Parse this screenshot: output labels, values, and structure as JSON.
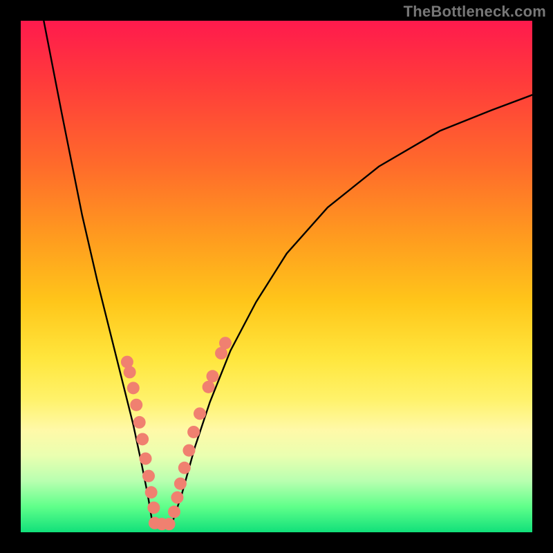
{
  "watermark": "TheBottleneck.com",
  "colors": {
    "curve": "#000000",
    "dot_fill": "#f08070",
    "dot_stroke": "#b0554a",
    "background_black": "#000000"
  },
  "chart_data": {
    "type": "line",
    "title": "",
    "xlabel": "",
    "ylabel": "",
    "xlim": [
      0,
      1
    ],
    "ylim": [
      0,
      1
    ],
    "series": [
      {
        "name": "left-branch",
        "x": [
          0.045,
          0.08,
          0.12,
          0.15,
          0.18,
          0.2,
          0.22,
          0.235,
          0.248,
          0.258
        ],
        "y": [
          1.0,
          0.82,
          0.62,
          0.49,
          0.37,
          0.29,
          0.21,
          0.14,
          0.075,
          0.015
        ]
      },
      {
        "name": "floor",
        "x": [
          0.258,
          0.295
        ],
        "y": [
          0.015,
          0.015
        ]
      },
      {
        "name": "right-branch",
        "x": [
          0.295,
          0.315,
          0.34,
          0.37,
          0.41,
          0.46,
          0.52,
          0.6,
          0.7,
          0.82,
          0.92,
          1.0
        ],
        "y": [
          0.015,
          0.075,
          0.165,
          0.255,
          0.355,
          0.45,
          0.545,
          0.635,
          0.715,
          0.785,
          0.825,
          0.855
        ]
      }
    ],
    "dot_groups": [
      {
        "name": "left-cluster",
        "points": [
          {
            "x": 0.208,
            "y": 0.333
          },
          {
            "x": 0.213,
            "y": 0.313
          },
          {
            "x": 0.22,
            "y": 0.282
          },
          {
            "x": 0.226,
            "y": 0.249
          },
          {
            "x": 0.232,
            "y": 0.215
          },
          {
            "x": 0.238,
            "y": 0.182
          },
          {
            "x": 0.244,
            "y": 0.144
          },
          {
            "x": 0.25,
            "y": 0.11
          },
          {
            "x": 0.255,
            "y": 0.078
          },
          {
            "x": 0.26,
            "y": 0.048
          }
        ]
      },
      {
        "name": "bottom-cluster",
        "points": [
          {
            "x": 0.262,
            "y": 0.018
          },
          {
            "x": 0.276,
            "y": 0.016
          },
          {
            "x": 0.29,
            "y": 0.016
          }
        ]
      },
      {
        "name": "right-cluster",
        "points": [
          {
            "x": 0.3,
            "y": 0.04
          },
          {
            "x": 0.306,
            "y": 0.068
          },
          {
            "x": 0.312,
            "y": 0.095
          },
          {
            "x": 0.32,
            "y": 0.126
          },
          {
            "x": 0.329,
            "y": 0.16
          },
          {
            "x": 0.338,
            "y": 0.196
          },
          {
            "x": 0.35,
            "y": 0.232
          },
          {
            "x": 0.367,
            "y": 0.284
          },
          {
            "x": 0.375,
            "y": 0.305
          }
        ]
      },
      {
        "name": "upper-right-pair",
        "points": [
          {
            "x": 0.392,
            "y": 0.35
          },
          {
            "x": 0.4,
            "y": 0.37
          }
        ]
      }
    ]
  }
}
